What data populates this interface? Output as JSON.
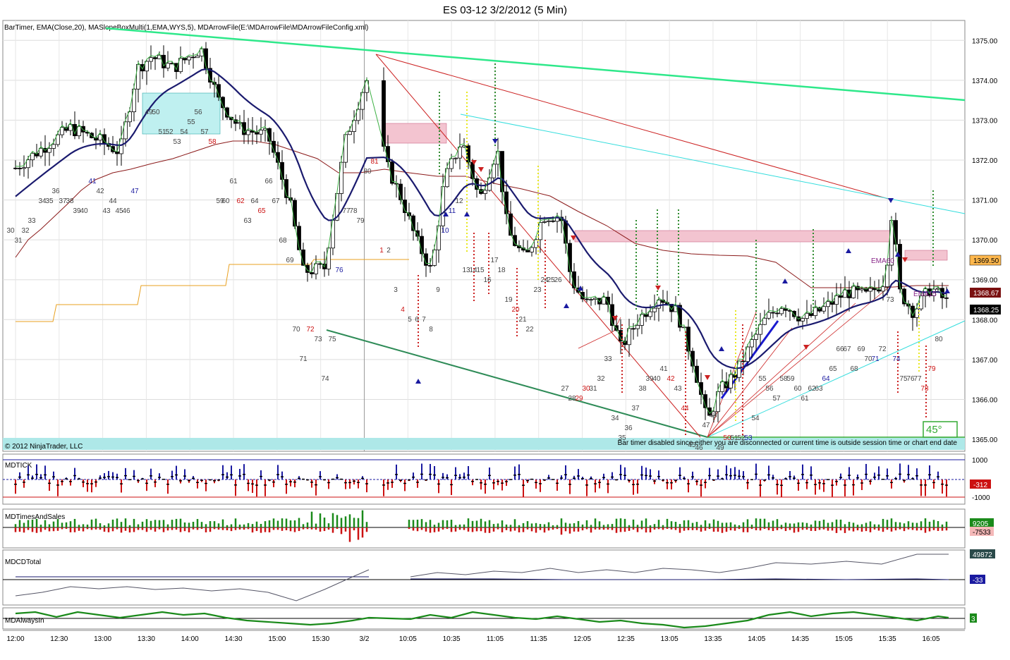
{
  "window_title": "ES 03-12  3/2/2012 (5 Min)",
  "indicator_text": "BarTimer, EMA(Close,20), MASlopeBoxMulti(1,EMA,WYS,5), MDArrowFile(E:\\MDArrowFile\\MDArrowFileConfig.xml)",
  "copyright": "© 2012 NinjaTrader, LLC",
  "bar_timer_message": "Bar timer disabled since either you are disconnected or current time is outside session time or chart end date",
  "angle_label": "45°",
  "ema_labels": [
    "EMA60",
    "EMA15"
  ],
  "colors": {
    "up_candle": "#ffffff",
    "down_candle": "#000000",
    "ema20": "#1a1a6e",
    "ema_green": "#3cb043",
    "trend_green": "#2ee88a",
    "trend_dark_green": "#2e8b57",
    "trend_red": "#cc2222",
    "trend_cyan": "#33dddd",
    "channel_red": "#8b1a1a",
    "channel_orange": "#e8a020",
    "tick_blue": "#1a1aa0",
    "tick_red": "#cc1111",
    "tas_green": "#1a8a1a",
    "tas_red": "#cc1111"
  },
  "chart_data": [
    {
      "type": "candlestick",
      "name": "ES 03-12",
      "ylim": [
        1364.7,
        1375.5
      ],
      "y_ticks": [
        "1375.00",
        "1374.00",
        "1373.00",
        "1372.00",
        "1371.00",
        "1370.00",
        "1369.00",
        "1368.00",
        "1367.00",
        "1366.00",
        "1365.00"
      ],
      "x_ticks": [
        "12:00",
        "12:30",
        "13:00",
        "13:30",
        "14:00",
        "14:30",
        "15:00",
        "15:30",
        "3/2",
        "10:05",
        "10:35",
        "11:05",
        "11:35",
        "12:05",
        "12:35",
        "13:05",
        "13:35",
        "14:05",
        "14:35",
        "15:05",
        "15:35",
        "16:05"
      ],
      "price_badges": [
        {
          "value": "1369.50",
          "bg": "#ffb84d",
          "fg": "#000000"
        },
        {
          "value": "1368.67",
          "bg": "#7a1010",
          "fg": "#ffffff"
        },
        {
          "value": "1368.25",
          "bg": "#000000",
          "fg": "#ffffff"
        }
      ],
      "bar_numbers": [
        "30",
        "31",
        "32",
        "33",
        "34",
        "35",
        "36",
        "37",
        "38",
        "39",
        "40",
        "41",
        "42",
        "43",
        "44",
        "45",
        "46",
        "47",
        "49",
        "50",
        "51",
        "52",
        "53",
        "54",
        "55",
        "56",
        "57",
        "58",
        "59",
        "60",
        "61",
        "62",
        "63",
        "64",
        "65",
        "66",
        "67",
        "68",
        "69",
        "70",
        "71",
        "72",
        "73",
        "74",
        "75",
        "76",
        "77",
        "78",
        "79",
        "80",
        "81",
        "1",
        "2",
        "3",
        "4",
        "5",
        "6",
        "7",
        "8",
        "9",
        "10",
        "11",
        "12",
        "13",
        "14",
        "15",
        "16",
        "17",
        "18",
        "19",
        "20",
        "21",
        "22",
        "23",
        "24",
        "25",
        "26",
        "27",
        "28",
        "29",
        "30",
        "31",
        "32",
        "33",
        "34",
        "35",
        "36",
        "37",
        "38",
        "39",
        "40",
        "41",
        "42",
        "43",
        "44",
        "45",
        "46",
        "47",
        "48",
        "49",
        "50",
        "51",
        "52",
        "53",
        "54",
        "55",
        "56",
        "57",
        "58",
        "59",
        "60",
        "61",
        "62",
        "63",
        "64",
        "65",
        "66",
        "67",
        "68",
        "69",
        "70",
        "71",
        "72",
        "73",
        "74",
        "75",
        "76",
        "77",
        "78",
        "79",
        "80"
      ]
    },
    {
      "type": "bar",
      "name": "MDTICK",
      "y_ticks": [
        "1000",
        "-1000"
      ],
      "last_value": "-312"
    },
    {
      "type": "bar",
      "name": "MDTimesAndSales",
      "last_values": [
        "9205",
        "-7533"
      ]
    },
    {
      "type": "line",
      "name": "MDCDTotal",
      "last_values": [
        "49872",
        "-33"
      ]
    },
    {
      "type": "line",
      "name": "MDAlwaysIn",
      "last_value": "3"
    }
  ]
}
